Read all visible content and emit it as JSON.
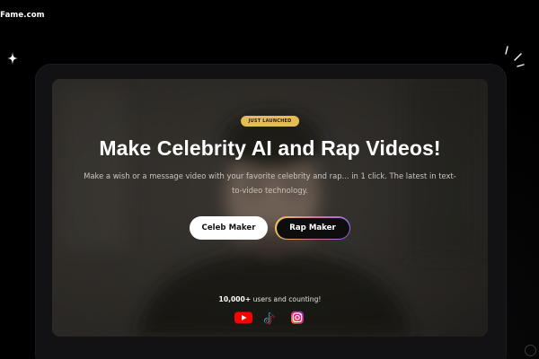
{
  "brand": {
    "name": "dFame.com"
  },
  "hero": {
    "badge": "JUST LAUNCHED",
    "headline": "Make Celebrity AI and Rap Videos!",
    "subtext": "Make a wish or a message video with your favorite celebrity and rap... in 1 click. The latest in text-to-video technology.",
    "buttons": {
      "celeb_label": "Celeb Maker",
      "rap_label": "Rap Maker"
    },
    "users": {
      "count": "10,000+",
      "suffix": " users and counting!"
    },
    "socials": [
      {
        "icon": "youtube-icon",
        "color": "#ff0000"
      },
      {
        "icon": "tiktok-icon",
        "color": "#25f4ee"
      },
      {
        "icon": "instagram-icon",
        "color": "#dd2a7b"
      }
    ]
  },
  "colors": {
    "background": "#000000",
    "badge": "#e2bd55",
    "accent_gradient": [
      "#f0c84e",
      "#e26ba0",
      "#9b6cf0"
    ]
  }
}
